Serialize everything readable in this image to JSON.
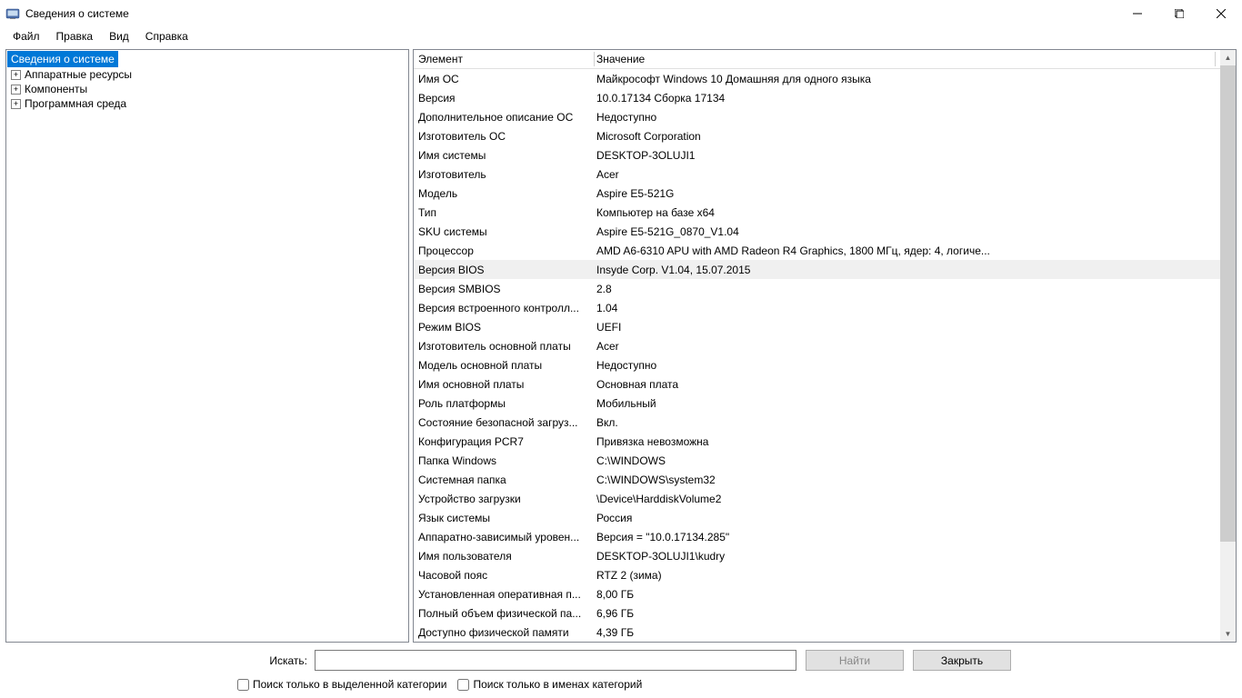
{
  "window": {
    "title": "Сведения о системе"
  },
  "menu": {
    "file": "Файл",
    "edit": "Правка",
    "view": "Вид",
    "help": "Справка"
  },
  "tree": {
    "root": "Сведения о системе",
    "children": [
      "Аппаратные ресурсы",
      "Компоненты",
      "Программная среда"
    ]
  },
  "columns": {
    "element": "Элемент",
    "value": "Значение"
  },
  "rows": [
    {
      "el": "Имя ОС",
      "val": "Майкрософт Windows 10 Домашняя для одного языка"
    },
    {
      "el": "Версия",
      "val": "10.0.17134 Сборка 17134"
    },
    {
      "el": "Дополнительное описание ОС",
      "val": "Недоступно"
    },
    {
      "el": "Изготовитель ОС",
      "val": "Microsoft Corporation"
    },
    {
      "el": "Имя системы",
      "val": "DESKTOP-3OLUJI1"
    },
    {
      "el": "Изготовитель",
      "val": "Acer"
    },
    {
      "el": "Модель",
      "val": "Aspire E5-521G"
    },
    {
      "el": "Тип",
      "val": "Компьютер на базе x64"
    },
    {
      "el": "SKU системы",
      "val": "Aspire E5-521G_0870_V1.04"
    },
    {
      "el": "Процессор",
      "val": "AMD A6-6310 APU with AMD Radeon R4 Graphics, 1800 МГц, ядер: 4, логиче..."
    },
    {
      "el": "Версия BIOS",
      "val": "Insyde Corp. V1.04, 15.07.2015",
      "hl": true
    },
    {
      "el": "Версия SMBIOS",
      "val": "2.8"
    },
    {
      "el": "Версия встроенного контролл...",
      "val": "1.04"
    },
    {
      "el": "Режим BIOS",
      "val": "UEFI"
    },
    {
      "el": "Изготовитель основной платы",
      "val": "Acer"
    },
    {
      "el": "Модель основной платы",
      "val": "Недоступно"
    },
    {
      "el": "Имя основной платы",
      "val": "Основная плата"
    },
    {
      "el": "Роль платформы",
      "val": "Мобильный"
    },
    {
      "el": "Состояние безопасной загруз...",
      "val": "Вкл."
    },
    {
      "el": "Конфигурация PCR7",
      "val": "Привязка невозможна"
    },
    {
      "el": "Папка Windows",
      "val": "C:\\WINDOWS"
    },
    {
      "el": "Системная папка",
      "val": "C:\\WINDOWS\\system32"
    },
    {
      "el": "Устройство загрузки",
      "val": "\\Device\\HarddiskVolume2"
    },
    {
      "el": "Язык системы",
      "val": "Россия"
    },
    {
      "el": "Аппаратно-зависимый уровен...",
      "val": "Версия = \"10.0.17134.285\""
    },
    {
      "el": "Имя пользователя",
      "val": "DESKTOP-3OLUJI1\\kudry"
    },
    {
      "el": "Часовой пояс",
      "val": "RTZ 2 (зима)"
    },
    {
      "el": "Установленная оперативная п...",
      "val": "8,00 ГБ"
    },
    {
      "el": "Полный объем физической па...",
      "val": "6,96 ГБ"
    },
    {
      "el": "Доступно физической памяти",
      "val": "4,39 ГБ"
    }
  ],
  "footer": {
    "search_label": "Искать:",
    "find_btn": "Найти",
    "close_btn": "Закрыть",
    "chk_selected": "Поиск только в выделенной категории",
    "chk_names": "Поиск только в именах категорий"
  }
}
